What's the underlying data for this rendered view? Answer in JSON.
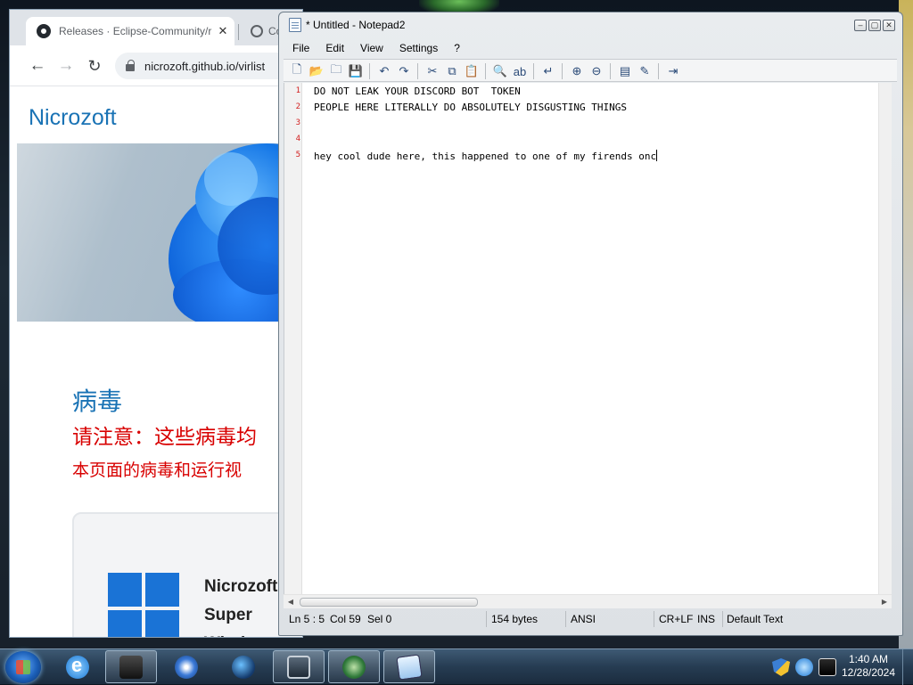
{
  "browser": {
    "tabs": [
      {
        "title": "Releases · Eclipse-Community/r",
        "icon": "github-icon"
      },
      {
        "title": "Co",
        "icon": "globe-icon"
      }
    ],
    "address": "nicrozoft.github.io/virlist",
    "site_logo": "Nicrozoft",
    "heading": "病毒",
    "warning_line1": "请注意：这些病毒均",
    "warning_line2": "本页面的病毒和运行视",
    "card_title_lines": [
      "Nicrozoft",
      "Super",
      "Windows"
    ]
  },
  "notepad": {
    "title": "* Untitled - Notepad2",
    "menu": [
      "File",
      "Edit",
      "View",
      "Settings",
      "?"
    ],
    "toolbar_icons": [
      "new-file-icon",
      "open-icon",
      "browse-icon",
      "save-icon",
      "undo-icon",
      "redo-icon",
      "cut-icon",
      "copy-icon",
      "paste-icon",
      "find-icon",
      "replace-icon",
      "word-wrap-icon",
      "zoom-in-icon",
      "zoom-out-icon",
      "scheme-icon",
      "customize-icon",
      "exit-icon"
    ],
    "lines": [
      {
        "num": "1",
        "text": "DO NOT LEAK YOUR DISCORD BOT  TOKEN"
      },
      {
        "num": "2",
        "text": "PEOPLE HERE LITERALLY DO ABSOLUTELY DISGUSTING THINGS"
      },
      {
        "num": "3",
        "text": ""
      },
      {
        "num": "4",
        "text": ""
      },
      {
        "num": "5",
        "text": "hey cool dude here, this happened to one of my firends onc"
      }
    ],
    "status": {
      "position": "Ln 5 : 5",
      "column": "Col 59",
      "selection": "Sel 0",
      "size": "154 bytes",
      "encoding": "ANSI",
      "line_endings": "CR+LF",
      "mode": "INS",
      "scheme": "Default Text"
    }
  },
  "taskbar": {
    "apps": [
      "internet-explorer-icon",
      "black-box-app-icon",
      "media-player-icon",
      "globe-app-icon",
      "monitor-app-icon",
      "green-circle-app-icon",
      "notepad-app-icon"
    ],
    "clock_time": "1:40 AM",
    "clock_date": "12/28/2024"
  }
}
